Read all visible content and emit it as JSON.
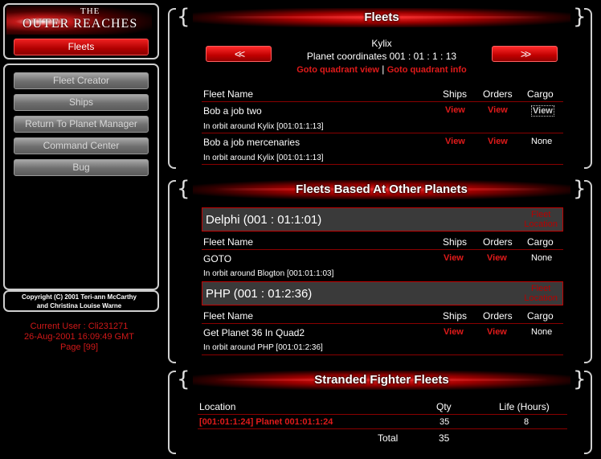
{
  "logo": {
    "the": "THE",
    "main": "OUTER REACHES"
  },
  "sidebar": {
    "active_button": "Fleets",
    "buttons": [
      "Fleet Creator",
      "Ships",
      "Return To Planet Manager",
      "Command Center",
      "Bug"
    ],
    "copyright": [
      "Copyright (C) 2001 Teri-ann McCarthy",
      "and Christina Louise Warne"
    ],
    "user_info": [
      "Current User : Cli231271",
      "26-Aug-2001 16:09:49 GMT",
      "Page [99]"
    ]
  },
  "fleets": {
    "title": "Fleets",
    "prev_label": "<<",
    "next_label": ">>",
    "planet_name": "Kylix",
    "coordinates": "Planet coordinates 001 : 01 : 1 : 13",
    "goto_quadrant_view": "Goto quadrant view",
    "separator": "|",
    "goto_quadrant_info": "Goto quadrant info",
    "headers": {
      "name": "Fleet Name",
      "ships": "Ships",
      "orders": "Orders",
      "cargo": "Cargo"
    },
    "rows": [
      {
        "name": "Bob a job two",
        "ships": "View",
        "orders": "View",
        "cargo": "View",
        "location": "In orbit around Kylix [001:01:1:13]"
      },
      {
        "name": "Bob a job mercenaries",
        "ships": "View",
        "orders": "View",
        "cargo": "None",
        "location": "In orbit around Kylix [001:01:1:13]"
      }
    ]
  },
  "other": {
    "title": "Fleets Based At Other Planets",
    "fleet_location": [
      "Fleet",
      "Location"
    ],
    "headers": {
      "name": "Fleet Name",
      "ships": "Ships",
      "orders": "Orders",
      "cargo": "Cargo"
    },
    "planets": [
      {
        "title": "Delphi (001 : 01:1:01)",
        "row": {
          "name": "GOTO",
          "ships": "View",
          "orders": "View",
          "cargo": "None",
          "location": "In orbit around Blogton [001:01:1:03]"
        }
      },
      {
        "title": "PHP (001 : 01:2:36)",
        "row": {
          "name": "Get Planet 36 In Quad2",
          "ships": "View",
          "orders": "View",
          "cargo": "None",
          "location": "In orbit around PHP [001:01:2:36]"
        }
      }
    ]
  },
  "stranded": {
    "title": "Stranded Fighter Fleets",
    "headers": {
      "location": "Location",
      "qty": "Qty",
      "life": "Life (Hours)"
    },
    "row": {
      "location": "[001:01:1:24] Planet 001:01:1:24",
      "qty": "35",
      "life": "8"
    },
    "total_label": "Total",
    "total_qty": "35"
  },
  "colors": {
    "accent_red": "#e01a1a",
    "frame": "#cfcfcf",
    "banner": "#c00000"
  }
}
